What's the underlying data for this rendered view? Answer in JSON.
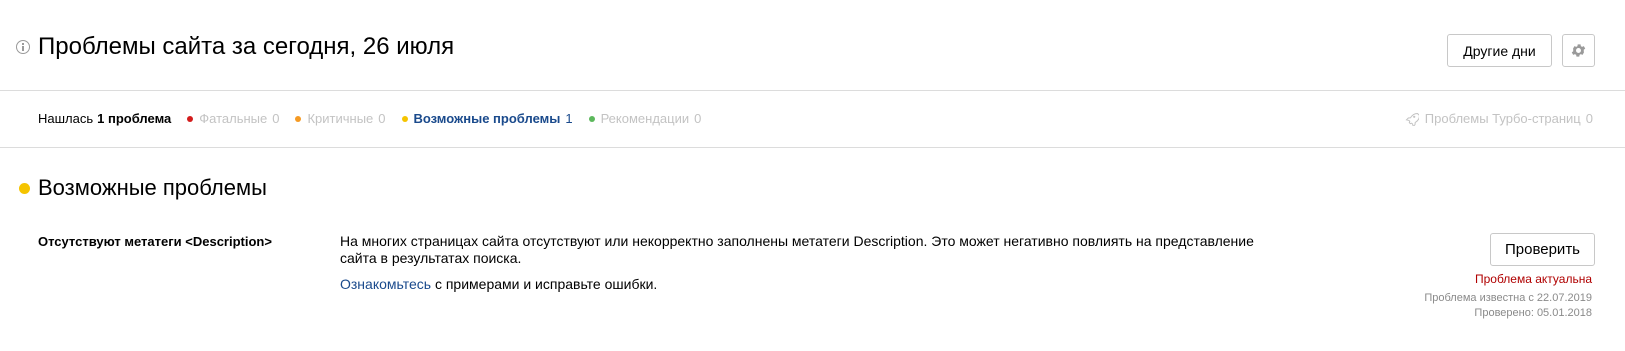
{
  "header": {
    "title": "Проблемы сайта за сегодня, 26 июля",
    "other_days_label": "Другие дни"
  },
  "filters": {
    "found_label": "Нашлась",
    "found_count": "1 проблема",
    "items": [
      {
        "label": "Фатальные",
        "count": "0",
        "color": "#d31c1c"
      },
      {
        "label": "Критичные",
        "count": "0",
        "color": "#f59a23"
      },
      {
        "label": "Возможные проблемы",
        "count": "1",
        "color": "#f5c400"
      },
      {
        "label": "Рекомендации",
        "count": "0",
        "color": "#5cb85c"
      }
    ],
    "turbo_label": "Проблемы Турбо-страниц",
    "turbo_count": "0"
  },
  "section": {
    "title": "Возможные проблемы",
    "color": "#f5c400"
  },
  "issue": {
    "name": "Отсутствуют метатеги <Description>",
    "description": "На многих страницах сайта отсутствуют или некорректно заполнены метатеги Description. Это может негативно повлиять на представление сайта в результатах поиска.",
    "hint_link": "Ознакомьтесь",
    "hint_rest": " с примерами и исправьте ошибки.",
    "check_label": "Проверить",
    "status": "Проблема актуальна",
    "known_since": "Проблема известна с 22.07.2019",
    "checked": "Проверено: 05.01.2018"
  },
  "colors": {
    "link": "#1a4a8c",
    "status_red": "#b00000"
  }
}
